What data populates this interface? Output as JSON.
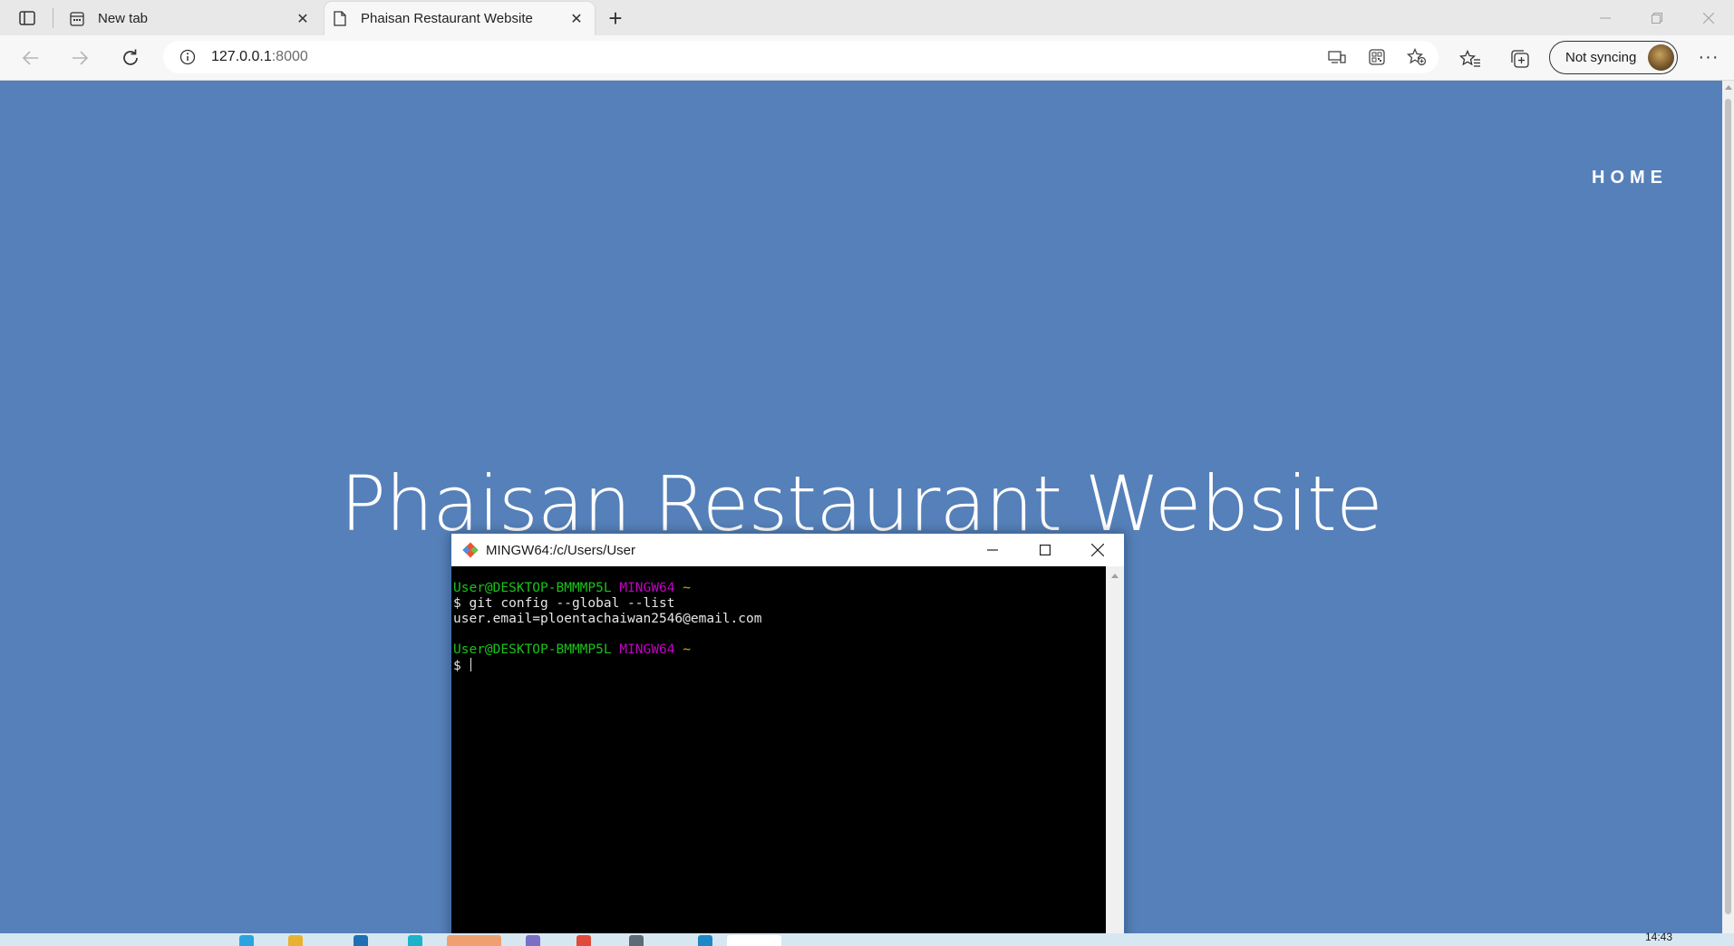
{
  "browser": {
    "tabs": [
      {
        "title": "New tab",
        "active": false,
        "icon": "new-tab-page-icon"
      },
      {
        "title": "Phaisan Restaurant Website",
        "active": true,
        "icon": "page-icon"
      }
    ],
    "address": {
      "host": "127.0.0.1",
      "port": ":8000"
    },
    "sync_label": "Not syncing",
    "more_label": "···"
  },
  "page": {
    "nav_home": "HOME",
    "hero_title": "Phaisan Restaurant Website",
    "background_color": "#5580b9"
  },
  "terminal": {
    "title": "MINGW64:/c/Users/User",
    "prompt_user": "User@DESKTOP-BMMMP5L",
    "prompt_system": "MINGW64",
    "prompt_path": "~",
    "command": "$ git config --global --list",
    "output": "user.email=ploentachaiwan2546@email.com",
    "prompt_symbol": "$ "
  },
  "taskbar": {
    "clock": "14:43"
  }
}
